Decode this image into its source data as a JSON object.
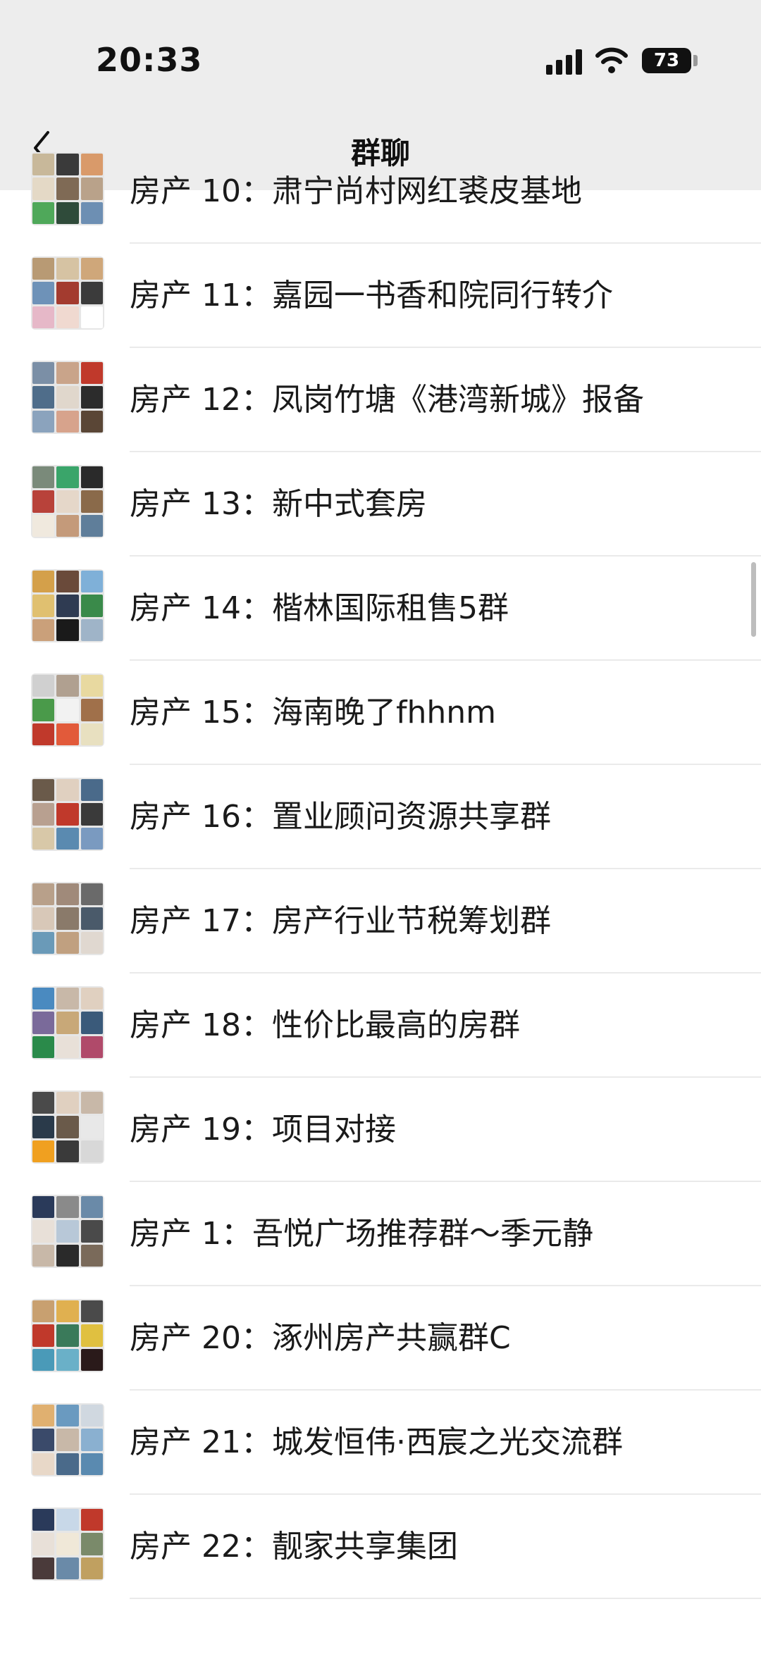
{
  "status_bar": {
    "time": "20:33",
    "battery": "73"
  },
  "nav": {
    "title": "群聊",
    "back_icon": "chevron-left-icon"
  },
  "groups": [
    {
      "label": "房产 10：肃宁尚村网红裘皮基地",
      "colors": [
        "#c8b89a",
        "#3a3a3a",
        "#d99a6a",
        "#e4d9c6",
        "#7f6a55",
        "#b9a28a",
        "#4fa85a",
        "#2f4b3a",
        "#6d8fb3"
      ]
    },
    {
      "label": "房产 11：嘉园一书香和院同行转介",
      "colors": [
        "#b89a74",
        "#d6c3a3",
        "#cfa77a",
        "#6e92b8",
        "#a33b2f",
        "#3b3b3b",
        "#e6b8c8",
        "#f0d9d0",
        "#ffffff"
      ]
    },
    {
      "label": "房产 12：凤岗竹塘《港湾新城》报备",
      "colors": [
        "#7b8fa6",
        "#c9a48a",
        "#c0392b",
        "#4f6d8a",
        "#e0d7cc",
        "#2c2c2c",
        "#8ba3bd",
        "#d7a38c",
        "#5a4636"
      ]
    },
    {
      "label": "房产 13：新中式套房",
      "colors": [
        "#7a8a7a",
        "#3aa56a",
        "#2a2a2a",
        "#b8423a",
        "#e5d7c9",
        "#8a6a4a",
        "#f0e9de",
        "#c49a7a",
        "#5f7e9a"
      ]
    },
    {
      "label": "房产 14：楷林国际租售5群",
      "colors": [
        "#d4a04a",
        "#6a4a3a",
        "#7fb0d8",
        "#e0c070",
        "#2f3b52",
        "#3a8a4a",
        "#caa07a",
        "#1a1a1a",
        "#9fb4c8"
      ]
    },
    {
      "label": "房产 15：海南晚了fhhnm",
      "colors": [
        "#d0d0d0",
        "#b0a090",
        "#e8d9a0",
        "#4a9a4a",
        "#f2f2f2",
        "#a0704a",
        "#c0392b",
        "#e25a3a",
        "#e8e0c0"
      ]
    },
    {
      "label": "房产 16：置业顾问资源共享群",
      "colors": [
        "#6a5a4a",
        "#e0d0c0",
        "#4a6a8a",
        "#b8a090",
        "#c0392b",
        "#3a3a3a",
        "#d8c8a8",
        "#5a8ab0",
        "#7a9ac0"
      ]
    },
    {
      "label": "房产 17：房产行业节税筹划群",
      "colors": [
        "#b8a08a",
        "#a08a7a",
        "#6a6a6a",
        "#d8c8b8",
        "#8a7a6a",
        "#4a5a6a",
        "#6a9ab8",
        "#c0a080",
        "#e0d8d0"
      ]
    },
    {
      "label": "房产 18：性价比最高的房群",
      "colors": [
        "#4a8ac0",
        "#c8b8a8",
        "#e0d0c0",
        "#7a6a9a",
        "#c8a878",
        "#3a5a7a",
        "#2a8a4a",
        "#e8e0d8",
        "#b04a6a"
      ]
    },
    {
      "label": "房产 19：项目对接",
      "colors": [
        "#4a4a4a",
        "#e0d0c0",
        "#c8b8a8",
        "#2a3a4a",
        "#6a5a4a",
        "#e8e8e8",
        "#f0a020",
        "#3a3a3a",
        "#d8d8d8"
      ]
    },
    {
      "label": "房产 1：吾悦广场推荐群～季元静",
      "colors": [
        "#2a3a5a",
        "#8a8a8a",
        "#6a8aa8",
        "#e8e0d8",
        "#b8c8d8",
        "#4a4a4a",
        "#c8b8a8",
        "#2a2a2a",
        "#7a6a5a"
      ]
    },
    {
      "label": "房产 20：涿州房产共赢群C",
      "colors": [
        "#c8a070",
        "#e0b050",
        "#4a4a4a",
        "#c0392b",
        "#3a7a5a",
        "#e0c040",
        "#4a9ab8",
        "#6ab0c8",
        "#2a1a1a"
      ]
    },
    {
      "label": "房产 21：城发恒伟·西宸之光交流群",
      "colors": [
        "#e0b070",
        "#6a9ac0",
        "#d0d8e0",
        "#3a4a6a",
        "#c8b8a8",
        "#8ab0d0",
        "#e8d8c8",
        "#4a6a8a",
        "#5a8ab0"
      ]
    },
    {
      "label": "房产 22：靓家共享集团",
      "colors": [
        "#2a3a5a",
        "#c8d8e8",
        "#c0392b",
        "#e8e0d8",
        "#f0e8d8",
        "#7a8a6a",
        "#4a3a3a",
        "#6a8aa8",
        "#c0a060"
      ]
    }
  ]
}
